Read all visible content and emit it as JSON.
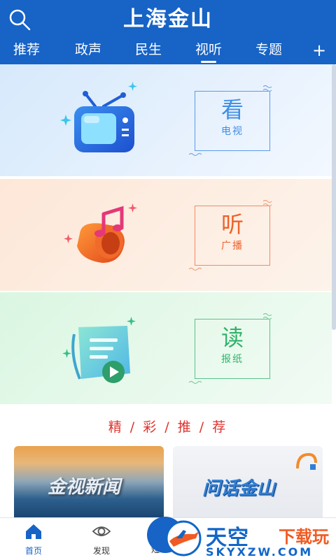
{
  "header": {
    "title": "上海金山",
    "tabs": [
      {
        "label": "推荐",
        "active": false
      },
      {
        "label": "政声",
        "active": false
      },
      {
        "label": "民生",
        "active": false
      },
      {
        "label": "视听",
        "active": true
      },
      {
        "label": "专题",
        "active": false
      }
    ],
    "plus": "+"
  },
  "cards": [
    {
      "big": "看",
      "small": "电视",
      "color": "#3f8ee6",
      "icon": "tv-icon"
    },
    {
      "big": "听",
      "small": "广播",
      "color": "#f0612a",
      "icon": "speaker-music-icon"
    },
    {
      "big": "读",
      "small": "报纸",
      "color": "#2fb46a",
      "icon": "newspaper-play-icon"
    }
  ],
  "section": {
    "title": "精 / 彩 / 推 / 荐"
  },
  "thumbnails": [
    {
      "text": "金视新闻"
    },
    {
      "text": "问话金山"
    }
  ],
  "bottom_nav": [
    {
      "label": "首页",
      "active": true,
      "icon": "home-icon"
    },
    {
      "label": "发现",
      "active": false,
      "icon": "eye-icon"
    },
    {
      "label": "短",
      "active": false,
      "icon": "short-video-icon"
    }
  ],
  "watermark": {
    "brand": "天空",
    "brand2": "下载玩",
    "url": "SKYXZW.COM"
  },
  "colors": {
    "header": "#1763c6",
    "accent_red": "#e0312b"
  }
}
